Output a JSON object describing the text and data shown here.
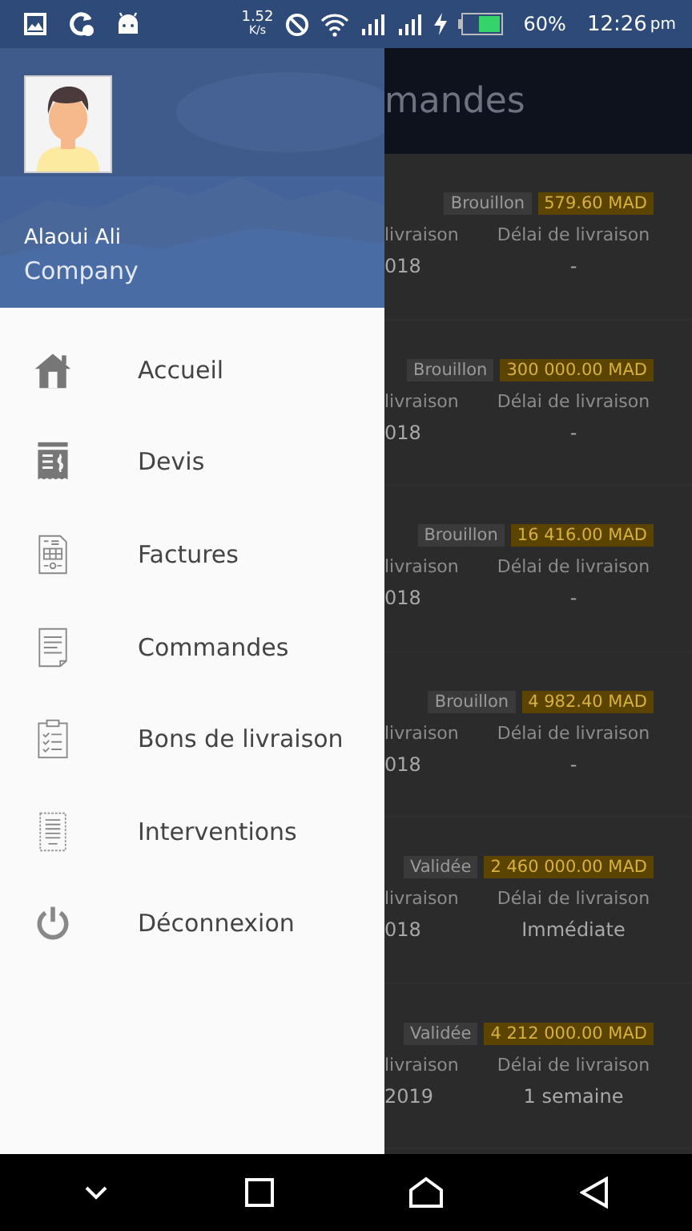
{
  "status_bar": {
    "speed": "1.52",
    "speed_unit": "K/s",
    "battery": "60%",
    "time": "12:26",
    "ampm": "pm"
  },
  "drawer": {
    "user": {
      "name": "Alaoui Ali",
      "company": "Company"
    },
    "items": [
      {
        "label": "Accueil",
        "kind": "home"
      },
      {
        "label": "Devis",
        "kind": "quote"
      },
      {
        "label": "Factures",
        "kind": "invoice"
      },
      {
        "label": "Commandes",
        "kind": "order"
      },
      {
        "label": "Bons de livraison",
        "kind": "delivery"
      },
      {
        "label": "Interventions",
        "kind": "intervention"
      },
      {
        "label": "Déconnexion",
        "kind": "power"
      }
    ]
  },
  "page": {
    "title": "mandes",
    "cards": [
      {
        "status": "Brouillon",
        "amount": "579.60 MAD",
        "column_1_header": "livraison",
        "column_2_header": "Délai de livraison",
        "column_1_value": "018",
        "column_2_value": "-"
      },
      {
        "status": "Brouillon",
        "amount": "300 000.00 MAD",
        "column_1_header": "livraison",
        "column_2_header": "Délai de livraison",
        "column_1_value": "018",
        "column_2_value": "-"
      },
      {
        "status": "Brouillon",
        "amount": "16 416.00 MAD",
        "column_1_header": "livraison",
        "column_2_header": "Délai de livraison",
        "column_1_value": "018",
        "column_2_value": "-"
      },
      {
        "status": "Brouillon",
        "amount": "4 982.40 MAD",
        "column_1_header": "livraison",
        "column_2_header": "Délai de livraison",
        "column_1_value": "018",
        "column_2_value": "-"
      },
      {
        "status": "Validée",
        "amount": "2 460 000.00 MAD",
        "column_1_header": "livraison",
        "column_2_header": "Délai de livraison",
        "column_1_value": "018",
        "column_2_value": "Immédiate"
      },
      {
        "status": "Validée",
        "amount": "4 212 000.00 MAD",
        "column_1_header": "livraison",
        "column_2_header": "Délai de livraison",
        "column_1_value": "2019",
        "column_2_value": "1 semaine"
      }
    ]
  }
}
